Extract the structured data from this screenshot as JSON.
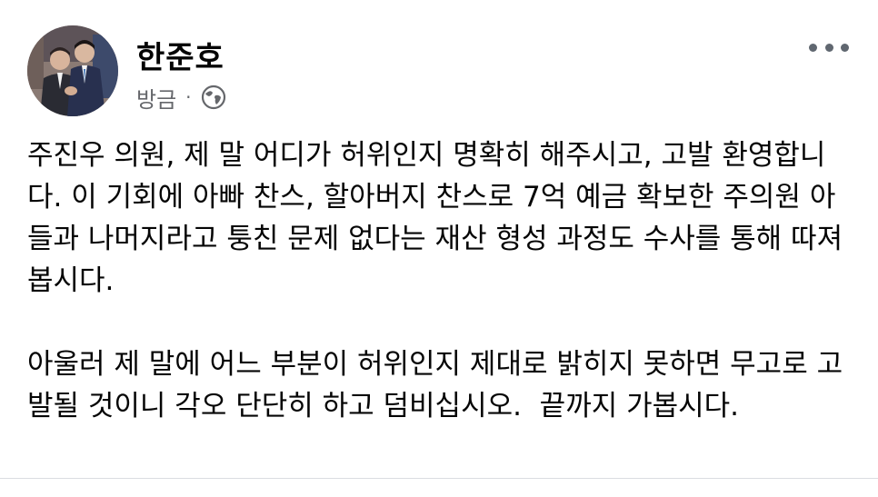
{
  "post": {
    "author": "한준호",
    "time": "방금",
    "separator": "·",
    "privacy_icon": "globe-icon",
    "more_icon": "more-options-icon",
    "paragraphs": [
      "주진우 의원, 제 말 어디가 허위인지 명확히 해주시고, 고발 환영합니다. 이 기회에 아빠 찬스, 할아버지 찬스로 7억 예금 확보한 주의원 아들과 나머지라고 퉁친 문제 없다는 재산 형성 과정도 수사를 통해 따져봅시다.",
      "아울러 제 말에 어느 부분이 허위인지 제대로 밝히지 못하면 무고로 고발될 것이니 각오 단단히 하고 덤비십시오.  끝까지 가봅시다."
    ]
  },
  "colors": {
    "text": "#050505",
    "meta": "#65676b",
    "icon": "#606770",
    "divider": "#dadde1"
  }
}
